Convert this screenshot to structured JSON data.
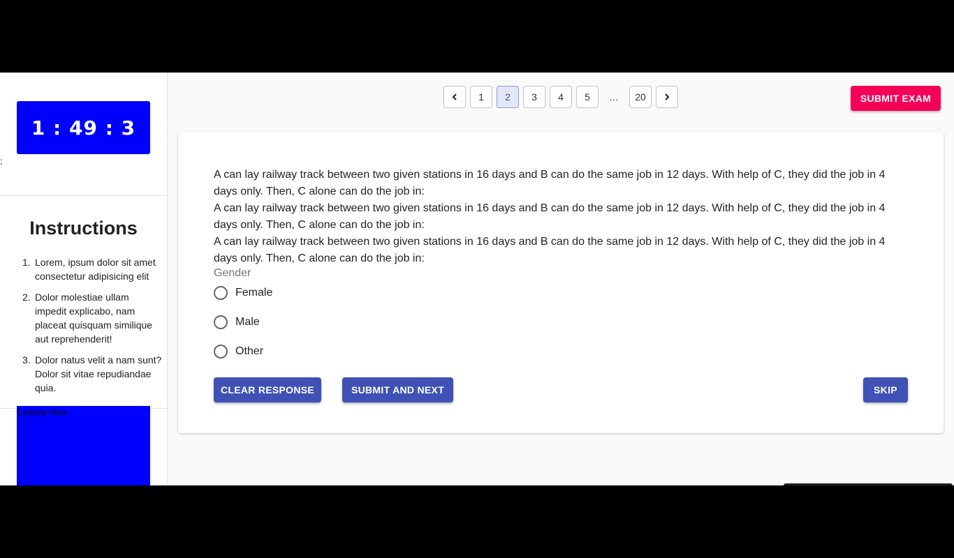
{
  "timer": {
    "display": "1 : 49 : 3"
  },
  "sidebar": {
    "stray_text": ";",
    "instructions_title": "Instructions",
    "instructions": [
      {
        "num": "1.",
        "text": "Lorem, ipsum dolor sit amet consectetur adipisicing elit"
      },
      {
        "num": "2.",
        "text": "Dolor molestiae ullam impedit explicabo, nam placeat quisquam similique aut reprehenderit!"
      },
      {
        "num": "3.",
        "text": "Dolor natus velit a nam sunt? Dolor sit vitae repudiandae quia."
      }
    ],
    "camera_label": "Camera View"
  },
  "pagination": {
    "prev_icon": "chevron-left-icon",
    "next_icon": "chevron-right-icon",
    "pages": [
      "1",
      "2",
      "3",
      "4",
      "5"
    ],
    "ellipsis": "…",
    "last_page": "20",
    "current_page": "2"
  },
  "header": {
    "submit_exam_label": "SUBMIT EXAM"
  },
  "question": {
    "paragraphs": [
      "A can lay railway track between two given stations in 16 days and B can do the same job in 12 days. With help of C, they did the job in 4 days only. Then, C alone can do the job in:",
      "A can lay railway track between two given stations in 16 days and B can do the same job in 12 days. With help of C, they did the job in 4 days only. Then, C alone can do the job in:",
      "A can lay railway track between two given stations in 16 days and B can do the same job in 12 days. With help of C, they did the job in 4 days only. Then, C alone can do the job in:"
    ],
    "group_label": "Gender",
    "options": [
      "Female",
      "Male",
      "Other"
    ]
  },
  "actions": {
    "clear_label": "CLEAR RESPONSE",
    "submit_next_label": "SUBMIT AND NEXT",
    "skip_label": "SKIP"
  },
  "colors": {
    "timer_bg": "#0000ff",
    "camera_bg": "#0000ff",
    "primary": "#3f51b5",
    "submit_exam": "#f50057"
  }
}
